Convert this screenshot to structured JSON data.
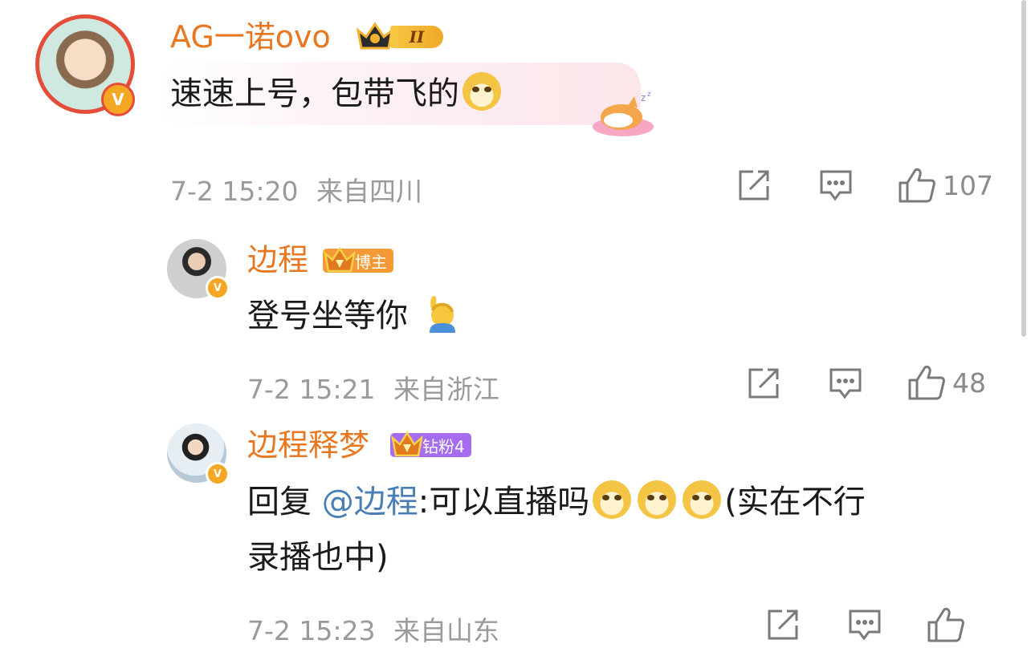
{
  "comments": [
    {
      "username": "AG一诺ovo",
      "level_badge": "II",
      "text": "速速上号，包带飞的",
      "time": "7-2 15:20",
      "location": "来自四川",
      "likes": "107"
    },
    {
      "username": "边程",
      "badge_label": "博主",
      "text": "登号坐等你",
      "time": "7-2 15:21",
      "location": "来自浙江",
      "likes": "48"
    },
    {
      "username": "边程释梦",
      "badge_label": "钻粉4",
      "reply_prefix": "回复",
      "mention": "@边程",
      "text_line1": ":可以直播吗",
      "text_line1_tail": "(实在不行",
      "text_line2": "录播也中)",
      "time": "7-2 15:23",
      "location": "来自山东"
    }
  ],
  "colors": {
    "username": "#e87722",
    "mention": "#4a7fb5",
    "meta": "#9a9a9a",
    "verified_badge": "#f5a623",
    "fan_badge": "#a56cf0",
    "blogger_badge": "#f39a36"
  },
  "icons": [
    "verified-badge-icon",
    "crown-icon",
    "doge-emoji",
    "person-raising-hand-emoji",
    "corgi-sticker",
    "share-icon",
    "comment-icon",
    "like-icon"
  ]
}
